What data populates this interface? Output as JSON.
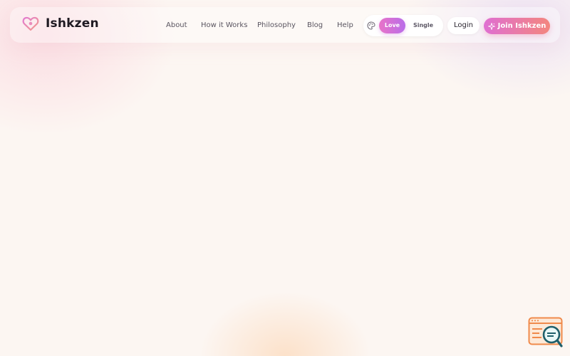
{
  "brand": {
    "name": "Ishkzen",
    "icon": "heart-outline-icon"
  },
  "nav": {
    "items": [
      {
        "label": "About"
      },
      {
        "label": "How it Works"
      },
      {
        "label": "Philosophy"
      },
      {
        "label": "Blog"
      },
      {
        "label": "Help"
      }
    ]
  },
  "mode_toggle": {
    "icon": "palette-icon",
    "options": [
      "Love",
      "Single"
    ],
    "selected": "Love"
  },
  "actions": {
    "login_label": "Login",
    "join_label": "Join Ishkzen",
    "join_icon": "sparkle-icon"
  },
  "colors": {
    "accent_start": "#df6fd2",
    "accent_end": "#f3867e",
    "toggle_start": "#e873c8",
    "toggle_end": "#b96de9",
    "background": "#fcf6f2"
  },
  "floating_widget": {
    "icon": "chat-search-icon"
  }
}
